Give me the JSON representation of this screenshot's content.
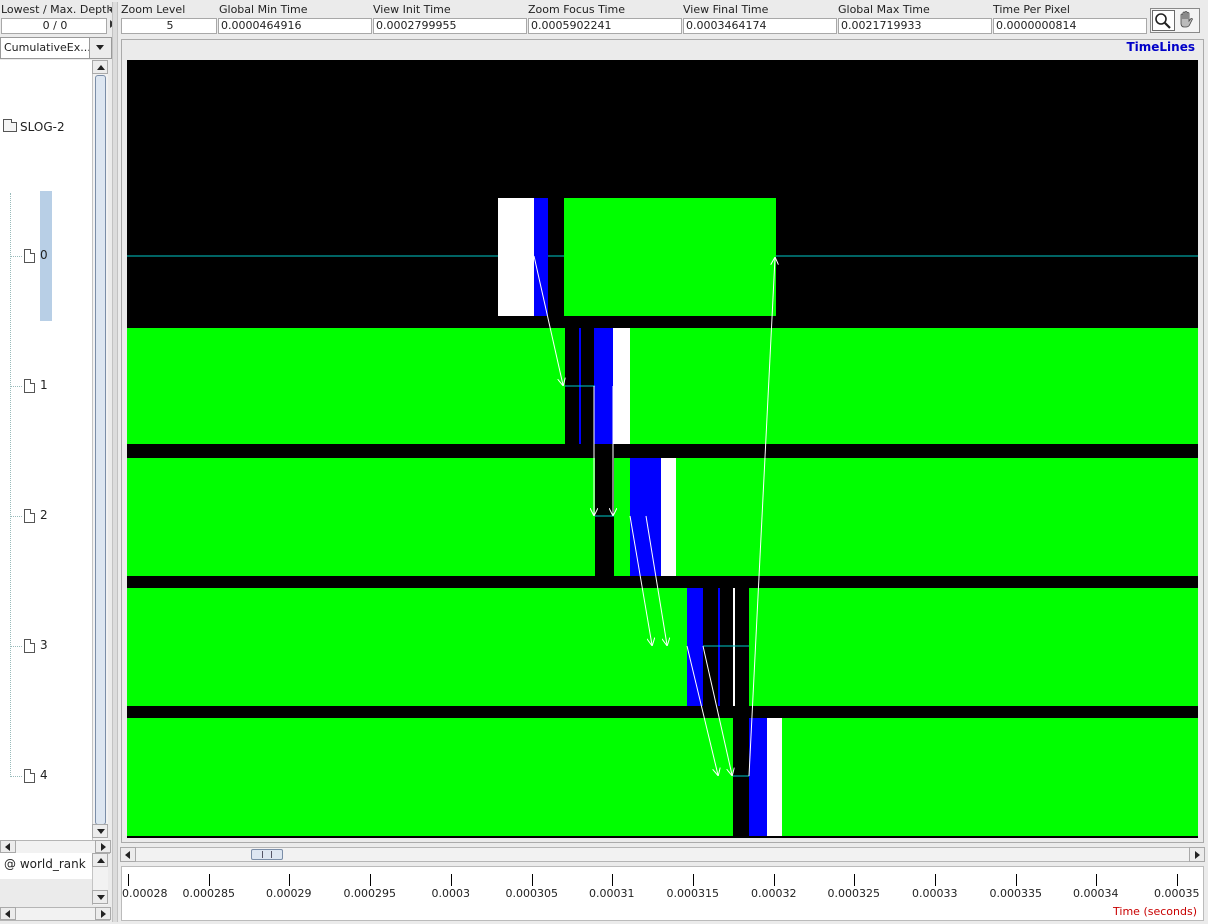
{
  "toolbar": {
    "depth_label": "Lowest / Max. Depth",
    "depth_value": "0 / 0",
    "fields": [
      {
        "label": "Zoom Level",
        "value": "5"
      },
      {
        "label": "Global Min Time",
        "value": "0.0000464916"
      },
      {
        "label": "View  Init Time",
        "value": "0.0002799955"
      },
      {
        "label": "Zoom Focus Time",
        "value": "0.0005902241"
      },
      {
        "label": "View Final Time",
        "value": "0.0003464174"
      },
      {
        "label": "Global Max Time",
        "value": "0.0021719933"
      },
      {
        "label": "Time Per Pixel",
        "value": "0.0000000814"
      }
    ],
    "tools": [
      "magnifier-icon",
      "hand-icon"
    ]
  },
  "sidebar": {
    "combo_value": "CumulativeEx...",
    "root_label": "SLOG-2",
    "ranks": [
      "0",
      "1",
      "2",
      "3",
      "4"
    ],
    "footer_label": "@ world_rank"
  },
  "timeline": {
    "title": "TimeLines",
    "axis_title": "Time (seconds)",
    "tick_labels": [
      "0.00028",
      "0.000285",
      "0.00029",
      "0.000295",
      "0.0003",
      "0.000305",
      "0.00031",
      "0.000315",
      "0.00032",
      "0.000325",
      "0.00033",
      "0.000335",
      "0.00034",
      "0.00035"
    ],
    "colors": {
      "background": "#000000",
      "compute": "#00ff00",
      "send": "#0000ff",
      "recv": "#ffffff",
      "arrow": "#ffffff",
      "timeline": "#00c8c8"
    }
  }
}
